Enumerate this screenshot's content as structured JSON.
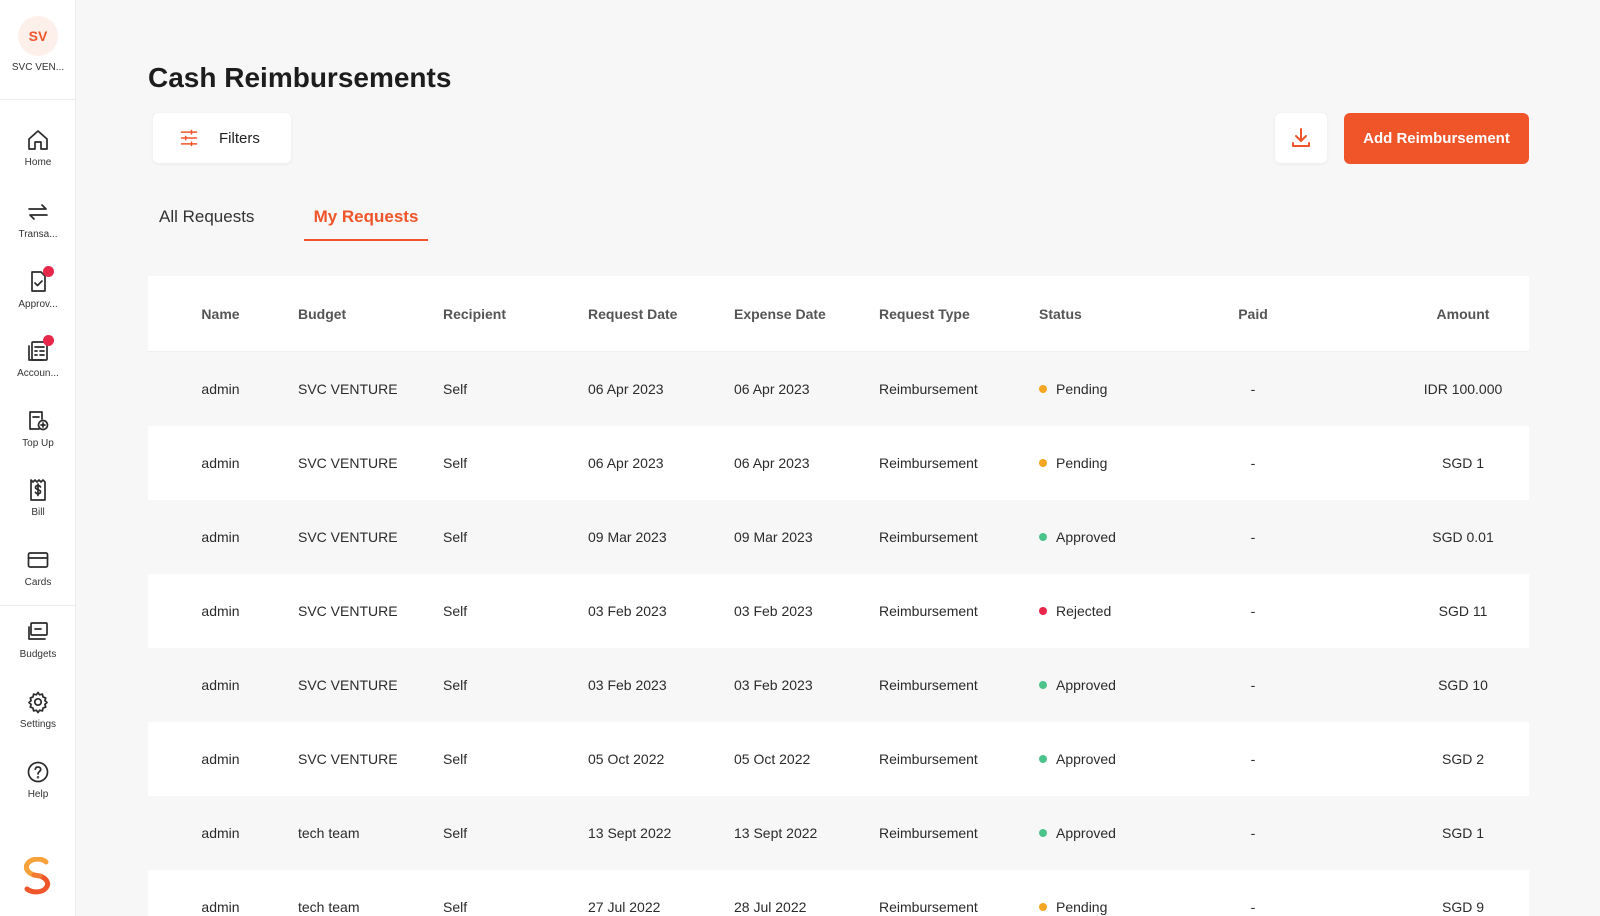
{
  "org": {
    "initials": "SV",
    "name": "SVC VEN..."
  },
  "nav": [
    {
      "label": "Home",
      "icon": "home-icon",
      "badge": false
    },
    {
      "label": "Transa...",
      "icon": "transfer-arrows-icon",
      "badge": false
    },
    {
      "label": "Approv...",
      "icon": "approval-document-icon",
      "badge": true
    },
    {
      "label": "Accoun...",
      "icon": "accounting-ledger-icon",
      "badge": true
    },
    {
      "label": "Top Up",
      "icon": "top-up-icon",
      "badge": false
    },
    {
      "label": "Bill",
      "icon": "bill-dollar-icon",
      "badge": false
    },
    {
      "label": "Cards",
      "icon": "card-icon",
      "badge": false
    },
    {
      "label": "Budgets",
      "icon": "budget-wallet-icon",
      "badge": false
    },
    {
      "label": "Settings",
      "icon": "gear-icon",
      "badge": false
    },
    {
      "label": "Help",
      "icon": "help-question-icon",
      "badge": false
    }
  ],
  "page": {
    "title": "Cash Reimbursements",
    "filters_label": "Filters",
    "add_label": "Add Reimbursement"
  },
  "tabs": [
    {
      "label": "All Requests",
      "active": false
    },
    {
      "label": "My Requests",
      "active": true
    }
  ],
  "table": {
    "headers": {
      "name": "Name",
      "budget": "Budget",
      "recipient": "Recipient",
      "request_date": "Request Date",
      "expense_date": "Expense Date",
      "request_type": "Request Type",
      "status": "Status",
      "paid": "Paid",
      "amount": "Amount"
    },
    "rows": [
      {
        "name": "admin",
        "budget": "SVC VENTURE",
        "recipient": "Self",
        "request_date": "06 Apr 2023",
        "expense_date": "06 Apr 2023",
        "request_type": "Reimbursement",
        "status": "Pending",
        "paid": "-",
        "amount": "IDR 100.000"
      },
      {
        "name": "admin",
        "budget": "SVC VENTURE",
        "recipient": "Self",
        "request_date": "06 Apr 2023",
        "expense_date": "06 Apr 2023",
        "request_type": "Reimbursement",
        "status": "Pending",
        "paid": "-",
        "amount": "SGD 1"
      },
      {
        "name": "admin",
        "budget": "SVC VENTURE",
        "recipient": "Self",
        "request_date": "09 Mar 2023",
        "expense_date": "09 Mar 2023",
        "request_type": "Reimbursement",
        "status": "Approved",
        "paid": "-",
        "amount": "SGD 0.01"
      },
      {
        "name": "admin",
        "budget": "SVC VENTURE",
        "recipient": "Self",
        "request_date": "03 Feb 2023",
        "expense_date": "03 Feb 2023",
        "request_type": "Reimbursement",
        "status": "Rejected",
        "paid": "-",
        "amount": "SGD 11"
      },
      {
        "name": "admin",
        "budget": "SVC VENTURE",
        "recipient": "Self",
        "request_date": "03 Feb 2023",
        "expense_date": "03 Feb 2023",
        "request_type": "Reimbursement",
        "status": "Approved",
        "paid": "-",
        "amount": "SGD 10"
      },
      {
        "name": "admin",
        "budget": "SVC VENTURE",
        "recipient": "Self",
        "request_date": "05 Oct 2022",
        "expense_date": "05 Oct 2022",
        "request_type": "Reimbursement",
        "status": "Approved",
        "paid": "-",
        "amount": "SGD 2"
      },
      {
        "name": "admin",
        "budget": "tech team",
        "recipient": "Self",
        "request_date": "13 Sept 2022",
        "expense_date": "13 Sept 2022",
        "request_type": "Reimbursement",
        "status": "Approved",
        "paid": "-",
        "amount": "SGD 1"
      },
      {
        "name": "admin",
        "budget": "tech team",
        "recipient": "Self",
        "request_date": "27 Jul 2022",
        "expense_date": "28 Jul 2022",
        "request_type": "Reimbursement",
        "status": "Pending",
        "paid": "-",
        "amount": "SGD 9"
      }
    ]
  },
  "status_colors": {
    "Pending": "#f5a623",
    "Approved": "#4cc38a",
    "Rejected": "#e8264a"
  },
  "accent_color": "#f0552a"
}
